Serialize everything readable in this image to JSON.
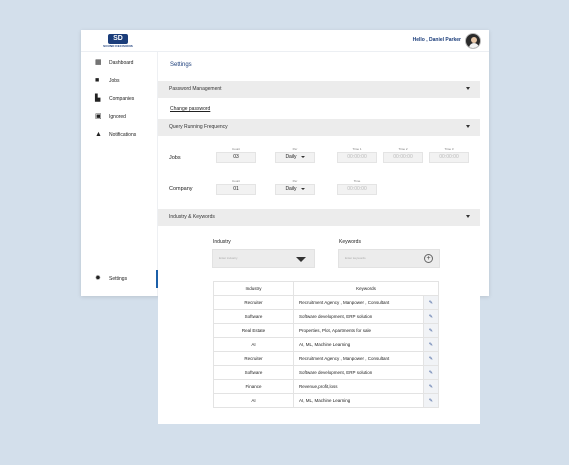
{
  "app": {
    "logo_text": "SD",
    "logo_caption": "SOUND DECISIONS",
    "greeting": "Hello , Daniel Parker"
  },
  "sidebar": {
    "items": [
      {
        "label": "Dashboard",
        "icon": "grid-icon"
      },
      {
        "label": "Jobs",
        "icon": "briefcase-icon"
      },
      {
        "label": "Companies",
        "icon": "building-icon"
      },
      {
        "label": "Ignored",
        "icon": "ignored-icon"
      },
      {
        "label": "Notifications",
        "icon": "bell-icon"
      }
    ],
    "settings_label": "Settings",
    "active_color": "#1b5fa8"
  },
  "main": {
    "title": "Settings",
    "password": {
      "header": "Password Management",
      "link": "Change password"
    },
    "frequency": {
      "header": "Query Running Frequency",
      "count_label": "Count",
      "per_label": "Per",
      "time_label": "Time",
      "time1_label": "Time 1",
      "time2_label": "Time 2",
      "time3_label": "Time 3",
      "jobs": {
        "label": "Jobs",
        "count": "03",
        "per": "Daily",
        "time1": "00:00:00",
        "time2": "00:00:00",
        "time3": "00:00:00"
      },
      "company": {
        "label": "Company",
        "count": "01",
        "per": "Daily",
        "time": "00:00:00"
      }
    },
    "industry_keywords": {
      "header": "Industry & Keywords",
      "industry_label": "Industry",
      "industry_placeholder": "Enter industry",
      "keywords_label": "Keywords",
      "keywords_placeholder": "Enter keywords",
      "table": {
        "headers": [
          "Industry",
          "Keywords"
        ],
        "rows": [
          {
            "industry": "Recruiter",
            "keywords": "Recruitment Agency , Manpower , Consultant"
          },
          {
            "industry": "Software",
            "keywords": "Software development, ERP solution"
          },
          {
            "industry": "Real Estate",
            "keywords": "Properties, Plot, Apartments for sale"
          },
          {
            "industry": "AI",
            "keywords": "AI, ML, Machine Learning"
          },
          {
            "industry": "Recruiter",
            "keywords": "Recruitment Agency , Manpower , Consultant"
          },
          {
            "industry": "Software",
            "keywords": "Software development, ERP solution"
          },
          {
            "industry": "Finance",
            "keywords": "Revenue,profit,loss"
          },
          {
            "industry": "AI",
            "keywords": "AI, ML, Machine Learning"
          }
        ]
      }
    }
  }
}
